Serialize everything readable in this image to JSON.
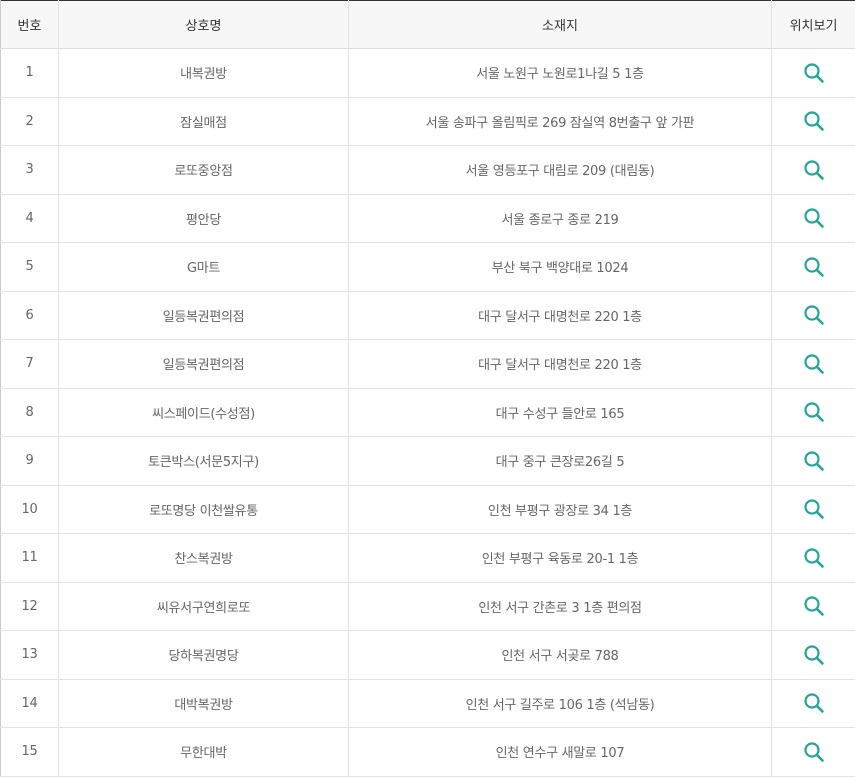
{
  "table": {
    "headers": [
      "번호",
      "상호명",
      "소재지",
      "위치보기"
    ],
    "icon": "search-icon",
    "accent_color": "#23a697",
    "rows": [
      {
        "no": "1",
        "name": "내복권방",
        "address": "서울 노원구 노원로1나길 5 1층"
      },
      {
        "no": "2",
        "name": "잠실매점",
        "address": "서울 송파구 올림픽로 269 잠실역 8번출구 앞 가판"
      },
      {
        "no": "3",
        "name": "로또중앙점",
        "address": "서울 영등포구 대림로 209 (대림동)"
      },
      {
        "no": "4",
        "name": "평안당",
        "address": "서울 종로구 종로 219"
      },
      {
        "no": "5",
        "name": "G마트",
        "address": "부산 북구 백양대로 1024"
      },
      {
        "no": "6",
        "name": "일등복권편의점",
        "address": "대구 달서구 대명천로 220 1층"
      },
      {
        "no": "7",
        "name": "일등복권편의점",
        "address": "대구 달서구 대명천로 220 1층"
      },
      {
        "no": "8",
        "name": "씨스페이드(수성점)",
        "address": "대구 수성구 들안로 165"
      },
      {
        "no": "9",
        "name": "토큰박스(서문5지구)",
        "address": "대구 중구 큰장로26길 5"
      },
      {
        "no": "10",
        "name": "로또명당 이천쌀유통",
        "address": "인천 부평구 광장로 34 1층"
      },
      {
        "no": "11",
        "name": "찬스복권방",
        "address": "인천 부평구 육동로 20-1 1층"
      },
      {
        "no": "12",
        "name": "씨유서구연희로또",
        "address": "인천 서구 간촌로 3 1층 편의점"
      },
      {
        "no": "13",
        "name": "당하복권명당",
        "address": "인천 서구 서곶로 788"
      },
      {
        "no": "14",
        "name": "대박복권방",
        "address": "인천 서구 길주로 106 1층 (석남동)"
      },
      {
        "no": "15",
        "name": "무한대박",
        "address": "인천 연수구 새말로 107"
      }
    ]
  }
}
